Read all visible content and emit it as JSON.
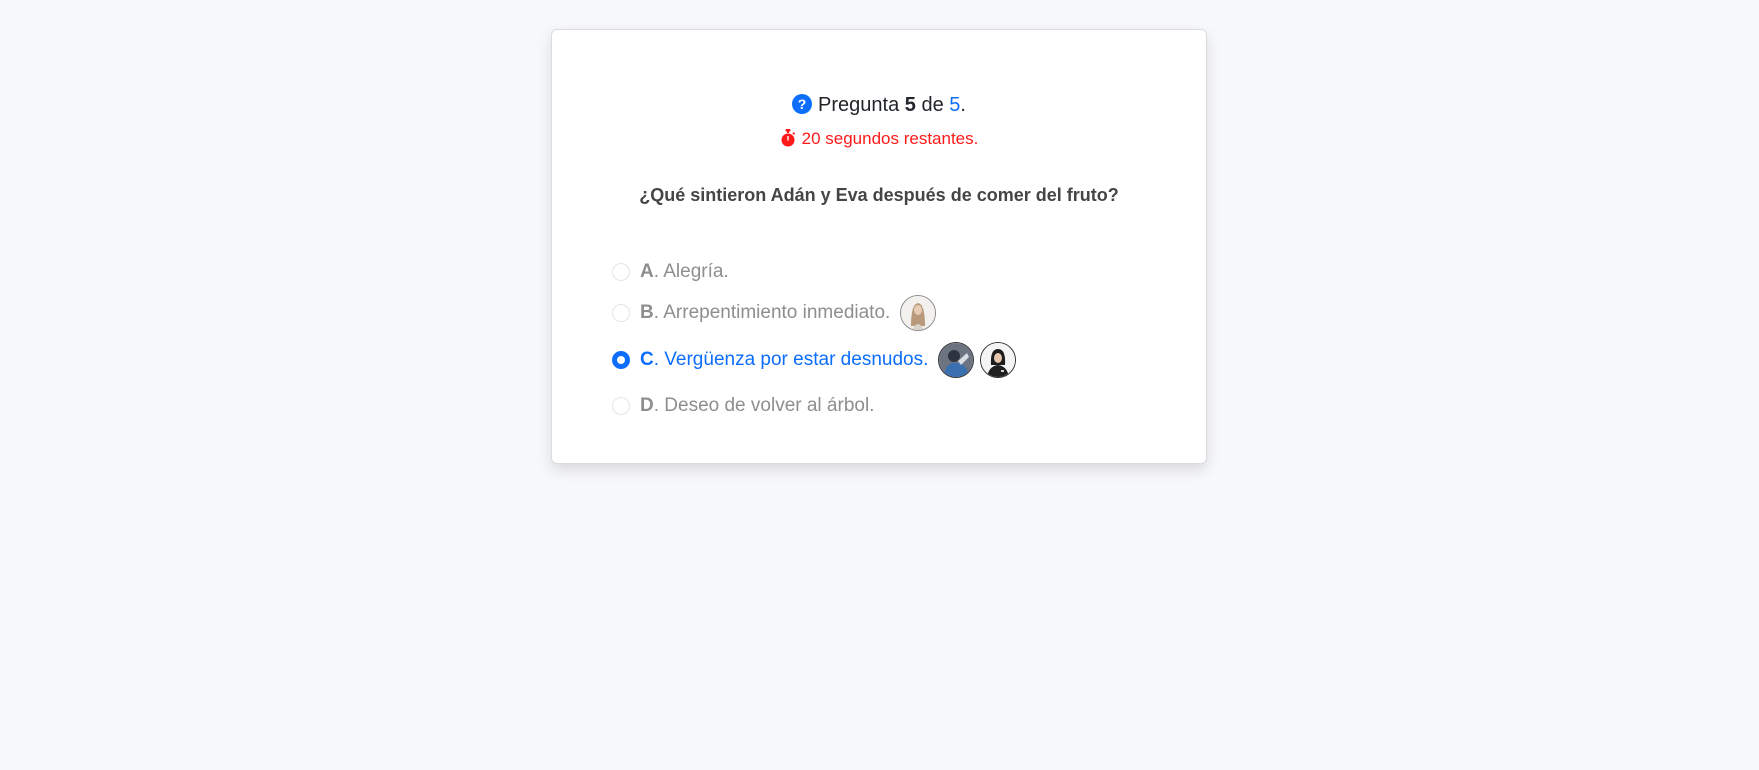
{
  "progress": {
    "prefix": "Pregunta",
    "current": "5",
    "middle": "de",
    "total": "5",
    "suffix": "."
  },
  "timer": {
    "text": "20 segundos restantes."
  },
  "question": {
    "text": "¿Qué sintieron Adán y Eva después de comer del fruto?"
  },
  "options": [
    {
      "letter": "A",
      "text": ". Alegría.",
      "selected": false
    },
    {
      "letter": "B",
      "text": ". Arrepentimiento inmediato.",
      "selected": false
    },
    {
      "letter": "C",
      "text": ". Vergüenza por estar desnudos.",
      "selected": true
    },
    {
      "letter": "D",
      "text": ". Deseo de volver al árbol.",
      "selected": false
    }
  ],
  "colors": {
    "accent": "#0d6efd",
    "timer": "#ff1a1a"
  }
}
